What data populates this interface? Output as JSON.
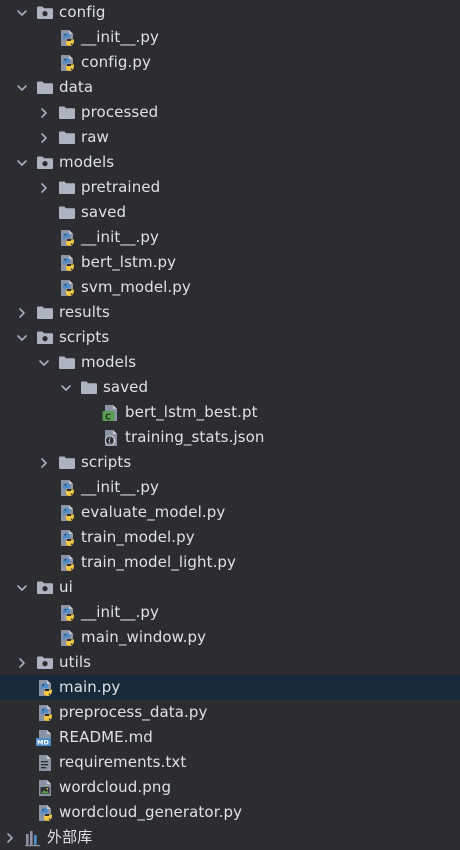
{
  "colors": {
    "background": "#2b2d30",
    "selected_row": "#172a3a",
    "text": "#dfe1e5",
    "folder": "#aeb3c1",
    "python_blue": "#4c8cc8",
    "python_yellow": "#f2c744",
    "chevron": "#a8adbd",
    "torch_green": "#5aa052"
  },
  "tree": [
    {
      "label": "config",
      "depth": 1,
      "kind": "folder-module",
      "expanded": true,
      "icon": "module-folder-icon"
    },
    {
      "label": "__init__.py",
      "depth": 2,
      "kind": "python",
      "icon": "python-file-icon"
    },
    {
      "label": "config.py",
      "depth": 2,
      "kind": "python",
      "icon": "python-file-icon"
    },
    {
      "label": "data",
      "depth": 1,
      "kind": "folder",
      "expanded": true,
      "icon": "folder-icon"
    },
    {
      "label": "processed",
      "depth": 2,
      "kind": "folder",
      "expanded": false,
      "icon": "folder-icon"
    },
    {
      "label": "raw",
      "depth": 2,
      "kind": "folder",
      "expanded": false,
      "icon": "folder-icon"
    },
    {
      "label": "models",
      "depth": 1,
      "kind": "folder-module",
      "expanded": true,
      "icon": "module-folder-icon"
    },
    {
      "label": "pretrained",
      "depth": 2,
      "kind": "folder",
      "expanded": false,
      "icon": "folder-icon"
    },
    {
      "label": "saved",
      "depth": 2,
      "kind": "folder",
      "icon": "folder-icon"
    },
    {
      "label": "__init__.py",
      "depth": 2,
      "kind": "python",
      "icon": "python-file-icon"
    },
    {
      "label": "bert_lstm.py",
      "depth": 2,
      "kind": "python",
      "icon": "python-file-icon"
    },
    {
      "label": "svm_model.py",
      "depth": 2,
      "kind": "python",
      "icon": "python-file-icon"
    },
    {
      "label": "results",
      "depth": 1,
      "kind": "folder",
      "expanded": false,
      "icon": "folder-icon"
    },
    {
      "label": "scripts",
      "depth": 1,
      "kind": "folder-module",
      "expanded": true,
      "icon": "module-folder-icon"
    },
    {
      "label": "models",
      "depth": 2,
      "kind": "folder",
      "expanded": true,
      "icon": "folder-icon"
    },
    {
      "label": "saved",
      "depth": 3,
      "kind": "folder",
      "expanded": true,
      "icon": "folder-icon"
    },
    {
      "label": "bert_lstm_best.pt",
      "depth": 4,
      "kind": "torch",
      "icon": "pytorch-file-icon"
    },
    {
      "label": "training_stats.json",
      "depth": 4,
      "kind": "json",
      "icon": "json-file-icon"
    },
    {
      "label": "scripts",
      "depth": 2,
      "kind": "folder",
      "expanded": false,
      "icon": "folder-icon"
    },
    {
      "label": "__init__.py",
      "depth": 2,
      "kind": "python",
      "icon": "python-file-icon"
    },
    {
      "label": "evaluate_model.py",
      "depth": 2,
      "kind": "python",
      "icon": "python-file-icon"
    },
    {
      "label": "train_model.py",
      "depth": 2,
      "kind": "python",
      "icon": "python-file-icon"
    },
    {
      "label": "train_model_light.py",
      "depth": 2,
      "kind": "python",
      "icon": "python-file-icon"
    },
    {
      "label": "ui",
      "depth": 1,
      "kind": "folder-module",
      "expanded": true,
      "icon": "module-folder-icon"
    },
    {
      "label": "__init__.py",
      "depth": 2,
      "kind": "python",
      "icon": "python-file-icon"
    },
    {
      "label": "main_window.py",
      "depth": 2,
      "kind": "python",
      "icon": "python-file-icon"
    },
    {
      "label": "utils",
      "depth": 1,
      "kind": "folder-module",
      "expanded": false,
      "icon": "module-folder-icon"
    },
    {
      "label": "main.py",
      "depth": 1,
      "kind": "python",
      "selected": true,
      "icon": "python-file-icon"
    },
    {
      "label": "preprocess_data.py",
      "depth": 1,
      "kind": "python",
      "icon": "python-file-icon"
    },
    {
      "label": "README.md",
      "depth": 1,
      "kind": "markdown",
      "icon": "markdown-file-icon"
    },
    {
      "label": "requirements.txt",
      "depth": 1,
      "kind": "text",
      "icon": "text-file-icon"
    },
    {
      "label": "wordcloud.png",
      "depth": 1,
      "kind": "image",
      "icon": "image-file-icon"
    },
    {
      "label": "wordcloud_generator.py",
      "depth": 1,
      "kind": "python",
      "icon": "python-file-icon"
    },
    {
      "label": "外部库",
      "depth": 0,
      "kind": "library",
      "expanded": false,
      "icon": "library-icon"
    }
  ]
}
